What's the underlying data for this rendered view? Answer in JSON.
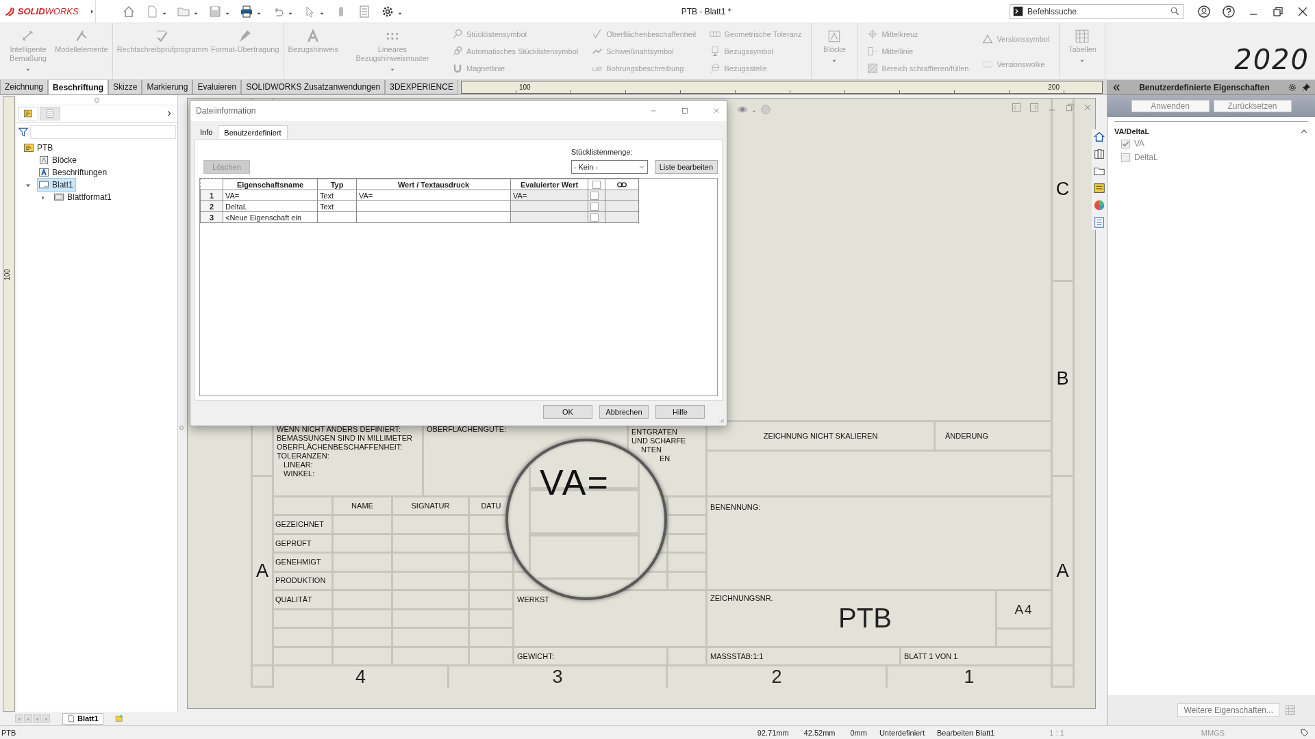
{
  "title_bar": {
    "logo": "**SOLID**WORKS",
    "title": "PTB - Blatt1 *",
    "search": {
      "placeholder": "Befehlssuche"
    }
  },
  "ribbon": {
    "groups": [
      {
        "columns": [
          {
            "kind": "large",
            "label": "Intelligente Bemaßung",
            "dropdown": true,
            "disabled": true
          },
          {
            "kind": "large",
            "label": "Modellelemente",
            "dropdown": false,
            "disabled": true
          }
        ]
      },
      {
        "columns": [
          {
            "kind": "large",
            "label": "Rechtschreibprüfprogramm",
            "dropdown": false,
            "disabled": true
          },
          {
            "kind": "large",
            "label": "Format-Übertragung",
            "dropdown": false,
            "disabled": true
          }
        ]
      },
      {
        "columns": [
          {
            "kind": "large",
            "label": "Bezugshinweis",
            "dropdown": false,
            "disabled": true
          },
          {
            "kind": "large",
            "label": "Lineares Bezugshinweismuster",
            "dropdown": true,
            "disabled": true
          },
          {
            "kind": "stack",
            "items": [
              {
                "label": "Stücklistensymbol",
                "disabled": true
              },
              {
                "label": "Automatisches Stücklistensymbol",
                "disabled": true
              },
              {
                "label": "Magnetlinie",
                "disabled": true
              }
            ]
          },
          {
            "kind": "stack",
            "items": [
              {
                "label": "Oberflächenbeschaffenheit",
                "disabled": true
              },
              {
                "label": "Schweißnahtsymbol",
                "disabled": true
              },
              {
                "label": "Bohrungsbeschreibung",
                "disabled": true
              }
            ]
          },
          {
            "kind": "stack",
            "items": [
              {
                "label": "Geometrische Toleranz",
                "disabled": true
              },
              {
                "label": "Bezugssymbol",
                "disabled": true
              },
              {
                "label": "Bezugsstelle",
                "disabled": true
              }
            ]
          }
        ]
      },
      {
        "columns": [
          {
            "kind": "large",
            "label": "Blöcke",
            "dropdown": true,
            "disabled": true
          }
        ]
      },
      {
        "columns": [
          {
            "kind": "stack",
            "items": [
              {
                "label": "Mittelkreuz",
                "disabled": true
              },
              {
                "label": "Mittellinie",
                "disabled": true
              },
              {
                "label": "Bereich schraffieren/füllen",
                "disabled": true
              }
            ]
          },
          {
            "kind": "stack",
            "items": [
              {
                "label": "Versionssymbol",
                "disabled": true
              },
              {
                "label": "Versionswolke",
                "disabled": true
              }
            ]
          }
        ]
      },
      {
        "columns": [
          {
            "kind": "large",
            "label": "Tabellen",
            "dropdown": true,
            "disabled": true
          }
        ]
      }
    ],
    "version_logo": "2020"
  },
  "command_tabs": [
    {
      "label": "Zeichnung",
      "selected": false
    },
    {
      "label": "Beschriftung",
      "selected": true
    },
    {
      "label": "Skizze",
      "selected": false
    },
    {
      "label": "Markierung",
      "selected": false
    },
    {
      "label": "Evaluieren",
      "selected": false
    },
    {
      "label": "SOLIDWORKS Zusatzanwendungen",
      "selected": false
    },
    {
      "label": "3DEXPERIENCE",
      "selected": false
    }
  ],
  "ruler": {
    "labels": [
      "100",
      "200"
    ]
  },
  "vertical_ruler": {
    "labels": [
      "100"
    ]
  },
  "feature_tree": {
    "items": [
      {
        "label": "PTB",
        "kind": "drawing",
        "selected": false,
        "children": [
          {
            "label": "Blöcke",
            "kind": "blocks",
            "selected": false
          },
          {
            "label": "Beschriftungen",
            "kind": "annotations",
            "selected": false
          },
          {
            "label": "Blatt1",
            "kind": "sheet",
            "selected": true,
            "expanded": true,
            "children": [
              {
                "label": "Blattformat1",
                "kind": "sheet-format",
                "selected": false,
                "expanded": false
              }
            ]
          }
        ]
      }
    ]
  },
  "sheet": {
    "zones_right": [
      "C",
      "B",
      "A"
    ],
    "zone_left": "A",
    "columns": [
      "4",
      "3",
      "2",
      "1"
    ],
    "title_block": {
      "notes": [
        "WENN NICHT ANDERS DEFINIERT:",
        "BEMASSUNGEN SIND IN MILLIMETER",
        "OBERFLÄCHENBESCHAFFENHEIT:",
        "TOLERANZEN:"
      ],
      "tolerances": [
        "LINEAR:",
        "WINKEL:"
      ],
      "surface_finish": "OBERFLÄCHENGÜTE:",
      "deburr": [
        "ENTGRATEN",
        "UND SCHARFE",
        "NTEN",
        "EN"
      ],
      "do_not_scale": "ZEICHNUNG NICHT SKALIEREN",
      "revision": "ÄNDERUNG",
      "approval_headers": [
        "NAME",
        "SIGNATUR",
        "DATU"
      ],
      "approval_rows": [
        "GEZEICHNET",
        "GEPRÜFT",
        "GENEHMIGT",
        "PRODUKTION",
        "QUALITÄT"
      ],
      "material": "WERKST",
      "weight": "GEWICHT:",
      "title_label": "BENENNUNG:",
      "drawing_number_label": "ZEICHNUNGSNR.",
      "drawing_number": "PTB",
      "size": "A4",
      "scale": "MASSSTAB:1:1",
      "sheet_count": "BLATT 1 VON 1"
    },
    "magnifier": {
      "text": "VA="
    }
  },
  "dialog": {
    "title": "Dateiinformation",
    "tabs": [
      {
        "label": "Info",
        "selected": false
      },
      {
        "label": "Benutzerdefiniert",
        "selected": true
      }
    ],
    "delete_button": {
      "label": "Löschen",
      "disabled": true
    },
    "bom_quantity": {
      "label": "Stücklistenmenge:",
      "value": "- Kein -"
    },
    "edit_list_button": "Liste bearbeiten",
    "table": {
      "columns": [
        "Eigenschaftsname",
        "Typ",
        "Wert / Textausdruck",
        "Evaluierter Wert"
      ],
      "header_checked": false,
      "rows": [
        {
          "number": "1",
          "name": "VA=",
          "type": "Text",
          "value": "VA=",
          "evaluated": "VA=",
          "checked": false
        },
        {
          "number": "2",
          "name": "DeltaL",
          "type": "Text",
          "checked": false
        },
        {
          "number": "3",
          "name": "<Neue Eigenschaft ein",
          "checked": false
        }
      ]
    },
    "buttons": [
      "OK",
      "Abbrechen",
      "Hilfe"
    ]
  },
  "property_panel": {
    "title": "Benutzerdefinierte Eigenschaften",
    "buttons": [
      {
        "label": "Anwenden",
        "disabled": true
      },
      {
        "label": "Zurücksetzen",
        "disabled": true
      }
    ],
    "section": {
      "title": "VA/DeltaL",
      "expanded": true,
      "items": [
        {
          "label": "VA",
          "checked": true,
          "disabled": true
        },
        {
          "label": "DeltaL",
          "checked": false,
          "disabled": true
        }
      ]
    },
    "more_button": "Weitere Eigenschaften..."
  },
  "sheet_tabs": [
    {
      "label": "Blatt1",
      "selected": true
    }
  ],
  "status_bar": {
    "document": "PTB",
    "x": "92.71mm",
    "y": "42.52mm",
    "z": "0mm",
    "state": "Unterdefiniert",
    "mode": "Bearbeiten Blatt1",
    "scale": "1 : 1",
    "units": "MMGS"
  }
}
